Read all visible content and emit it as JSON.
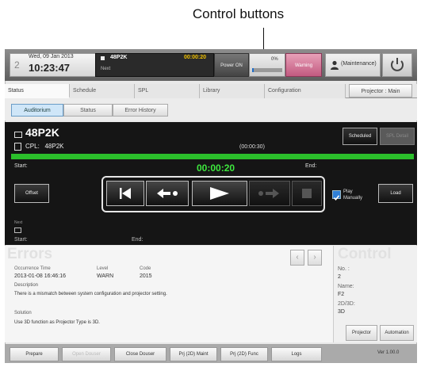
{
  "callout": {
    "title": "Control buttons"
  },
  "header": {
    "day_number": "2",
    "date": "Wed, 09 Jan 2013",
    "time": "10:23:47",
    "show_name": "48P2K",
    "show_time": "00:00:20",
    "show_next": "Next",
    "power_label": "Power ON",
    "progress_text": "0%",
    "progress_fraction": 0.05,
    "warning_label": "Warning",
    "user_name": "(Maintenance)"
  },
  "tabs": [
    {
      "label": "Status"
    },
    {
      "label": "Schedule"
    },
    {
      "label": "SPL"
    },
    {
      "label": "Library"
    },
    {
      "label": "Configuration"
    }
  ],
  "projector_button": "Projector : Main",
  "subtabs": [
    {
      "label": "Auditorium"
    },
    {
      "label": "Status"
    },
    {
      "label": "Error History"
    }
  ],
  "player": {
    "title": "48P2K",
    "cpl_label": "CPL:",
    "cpl_value": "48P2K",
    "duration": "(00:00:30)",
    "scheduled_label": "Scheduled",
    "spl_detail_label": "SPL Detail",
    "start_label": "Start:",
    "current_time": "00:00:20",
    "end_label": "End:",
    "offset_label": "Offset",
    "play_manually_label": "Play Manually",
    "play_manually_checked": true,
    "load_label": "Load",
    "next_label": "Next",
    "next_start_label": "Start:",
    "next_end_label": "End:"
  },
  "errors": {
    "heading": "Errors",
    "col_occurrence": "Occurrence Time",
    "col_level": "Level",
    "col_code": "Code",
    "occurrence_time": "2013-01-08 16:46:16",
    "level": "WARN",
    "code": "2015",
    "description_label": "Description",
    "description": "There is a mismatch between system configuration and projector setting.",
    "solution_label": "Solution",
    "solution": "Use 3D function as Projector Type is 3D.",
    "prev_icon": "chevron-left-icon",
    "next_icon": "chevron-right-icon"
  },
  "control": {
    "heading": "Control",
    "no_label": "No. :",
    "no_value": "2",
    "name_label": "Name:",
    "name_value": "F2",
    "mode_label": "2D/3D:",
    "mode_value": "3D",
    "projector_button": "Projector",
    "automation_button": "Automation"
  },
  "footer": {
    "buttons": [
      "Prepare",
      "Open Douser",
      "Close Douser",
      "Prj (2D) Maint",
      "Prj (2D) Func",
      "Logs"
    ],
    "version": "Ver 1.00.0"
  },
  "icons": [
    "skip-to-start-icon",
    "rewind-icon",
    "play-icon",
    "fast-forward-icon",
    "stop-icon",
    "user-icon",
    "power-icon",
    "screen-icon",
    "file-icon",
    "check-icon"
  ]
}
